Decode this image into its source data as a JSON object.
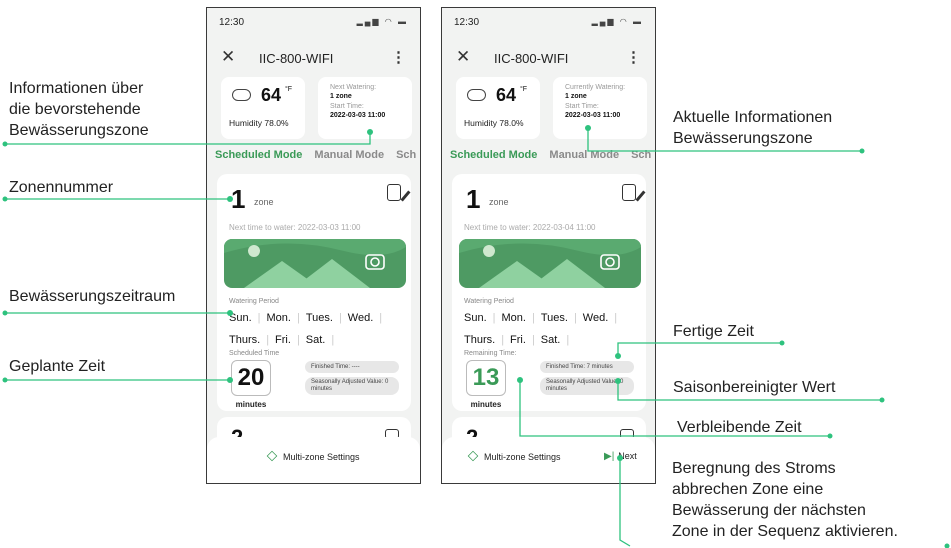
{
  "screen1": {
    "status_time": "12:30",
    "status_icons": "▂▄▆ ◠ ▬",
    "title": "IIC-800-WIFI",
    "weather": {
      "temp": "64",
      "unit": "°F",
      "humidity": "Humidity 78.0%"
    },
    "info": {
      "header": "Next Watering:",
      "zone": "1 zone",
      "start_label": "Start Time:",
      "start_value": "2022-03-03 11:00"
    },
    "tabs": [
      "Scheduled Mode",
      "Manual Mode",
      "Sch"
    ],
    "zone_card": {
      "number": "1",
      "zone_word": "zone",
      "next_time": "Next time to water: 2022-03-03 11:00",
      "period_label": "Watering Period",
      "days": [
        "Sun.",
        "Mon.",
        "Tues.",
        "Wed.",
        "Thurs.",
        "Fri.",
        "Sat."
      ],
      "time_label": "Scheduled Time",
      "time_value": "20",
      "minutes": "minutes",
      "finished": "Finished Time: ----",
      "seasonal": "Seasonally Adjusted Value: 0 minutes"
    },
    "zone2_number": "2",
    "bottom": {
      "multi": "Multi-zone Settings"
    }
  },
  "screen2": {
    "status_time": "12:30",
    "status_icons": "▂▄▆ ◠ ▬",
    "title": "IIC-800-WIFI",
    "weather": {
      "temp": "64",
      "unit": "°F",
      "humidity": "Humidity 78.0%"
    },
    "info": {
      "header": "Currently Watering:",
      "zone": "1 zone",
      "start_label": "Start Time:",
      "start_value": "2022-03-03 11:00"
    },
    "tabs": [
      "Scheduled Mode",
      "Manual Mode",
      "Sch"
    ],
    "zone_card": {
      "number": "1",
      "zone_word": "zone",
      "next_time": "Next time to water: 2022-03-04 11:00",
      "period_label": "Watering Period",
      "days": [
        "Sun.",
        "Mon.",
        "Tues.",
        "Wed.",
        "Thurs.",
        "Fri.",
        "Sat."
      ],
      "time_label": "Remaining Time:",
      "time_value": "13",
      "minutes": "minutes",
      "finished": "Finished Time: 7 minutes",
      "seasonal": "Seasonally Adjusted Value: 0 minutes"
    },
    "zone2_number": "2",
    "bottom": {
      "multi": "Multi-zone Settings",
      "next": "Next"
    }
  },
  "callouts": {
    "upcoming_info": "Informationen über\ndie bevorstehende\nBewässerungszone",
    "zone_number": "Zonennummer",
    "watering_period": "Bewässerungszeitraum",
    "scheduled_time": "Geplante Zeit",
    "current_info": "Aktuelle Informationen\nBewässerungszone",
    "finished_time": "Fertige Zeit",
    "seasonal_value": "Saisonbereinigter Wert",
    "remaining_time": "Verbleibende Zeit",
    "next_desc": "Beregnung des Stroms\nabbrechen Zone eine\nBewässerung der nächsten\nZone in der Sequenz aktivieren."
  },
  "colors": {
    "accent": "#3a9a57",
    "callout_line": "#2ec27e"
  }
}
